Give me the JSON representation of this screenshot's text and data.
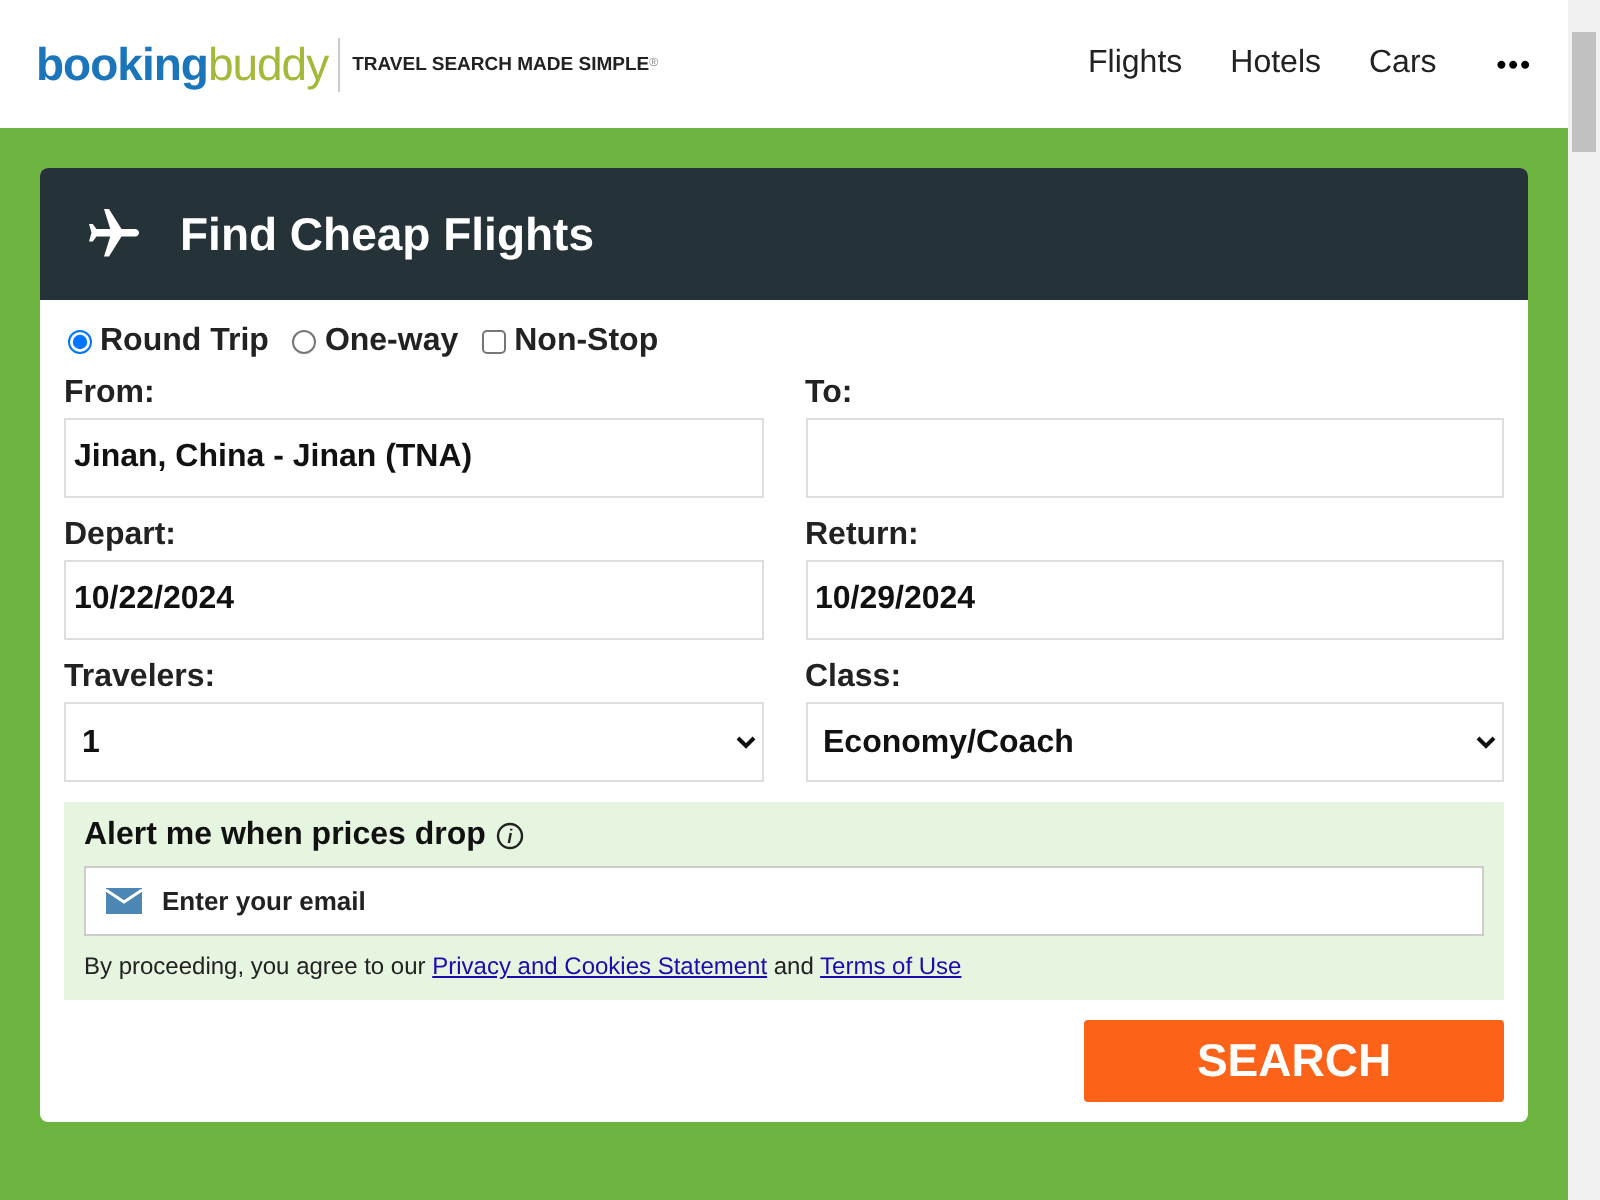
{
  "header": {
    "logo": {
      "first": "booking",
      "second": "buddy",
      "tagline": "TRAVEL SEARCH MADE SIMPLE",
      "mark": "®"
    },
    "nav": [
      {
        "label": "Flights"
      },
      {
        "label": "Hotels"
      },
      {
        "label": "Cars"
      }
    ],
    "more": "•••"
  },
  "card": {
    "title": "Find Cheap Flights",
    "trip_options": [
      {
        "kind": "radio",
        "label": "Round Trip",
        "checked": true
      },
      {
        "kind": "radio",
        "label": "One-way",
        "checked": false
      },
      {
        "kind": "checkbox",
        "label": "Non-Stop",
        "checked": false
      }
    ],
    "fields": [
      {
        "kind": "text",
        "label": "From:",
        "value": "Jinan, China - Jinan (TNA)"
      },
      {
        "kind": "text",
        "label": "To:"
      },
      {
        "kind": "text",
        "label": "Depart:",
        "value": "10/22/2024"
      },
      {
        "kind": "text",
        "label": "Return:",
        "value": "10/29/2024"
      },
      {
        "kind": "select",
        "label": "Travelers:",
        "value": "1"
      },
      {
        "kind": "select",
        "label": "Class:",
        "value": "Economy/Coach"
      }
    ],
    "alert": {
      "title": "Alert me when prices drop",
      "email_placeholder": "Enter your email",
      "consent": {
        "before": "By proceeding, you agree to our",
        "link1": "Privacy and Cookies Statement",
        "middle": "and",
        "link2": "Terms of Use"
      }
    },
    "search_button": "SEARCH"
  }
}
